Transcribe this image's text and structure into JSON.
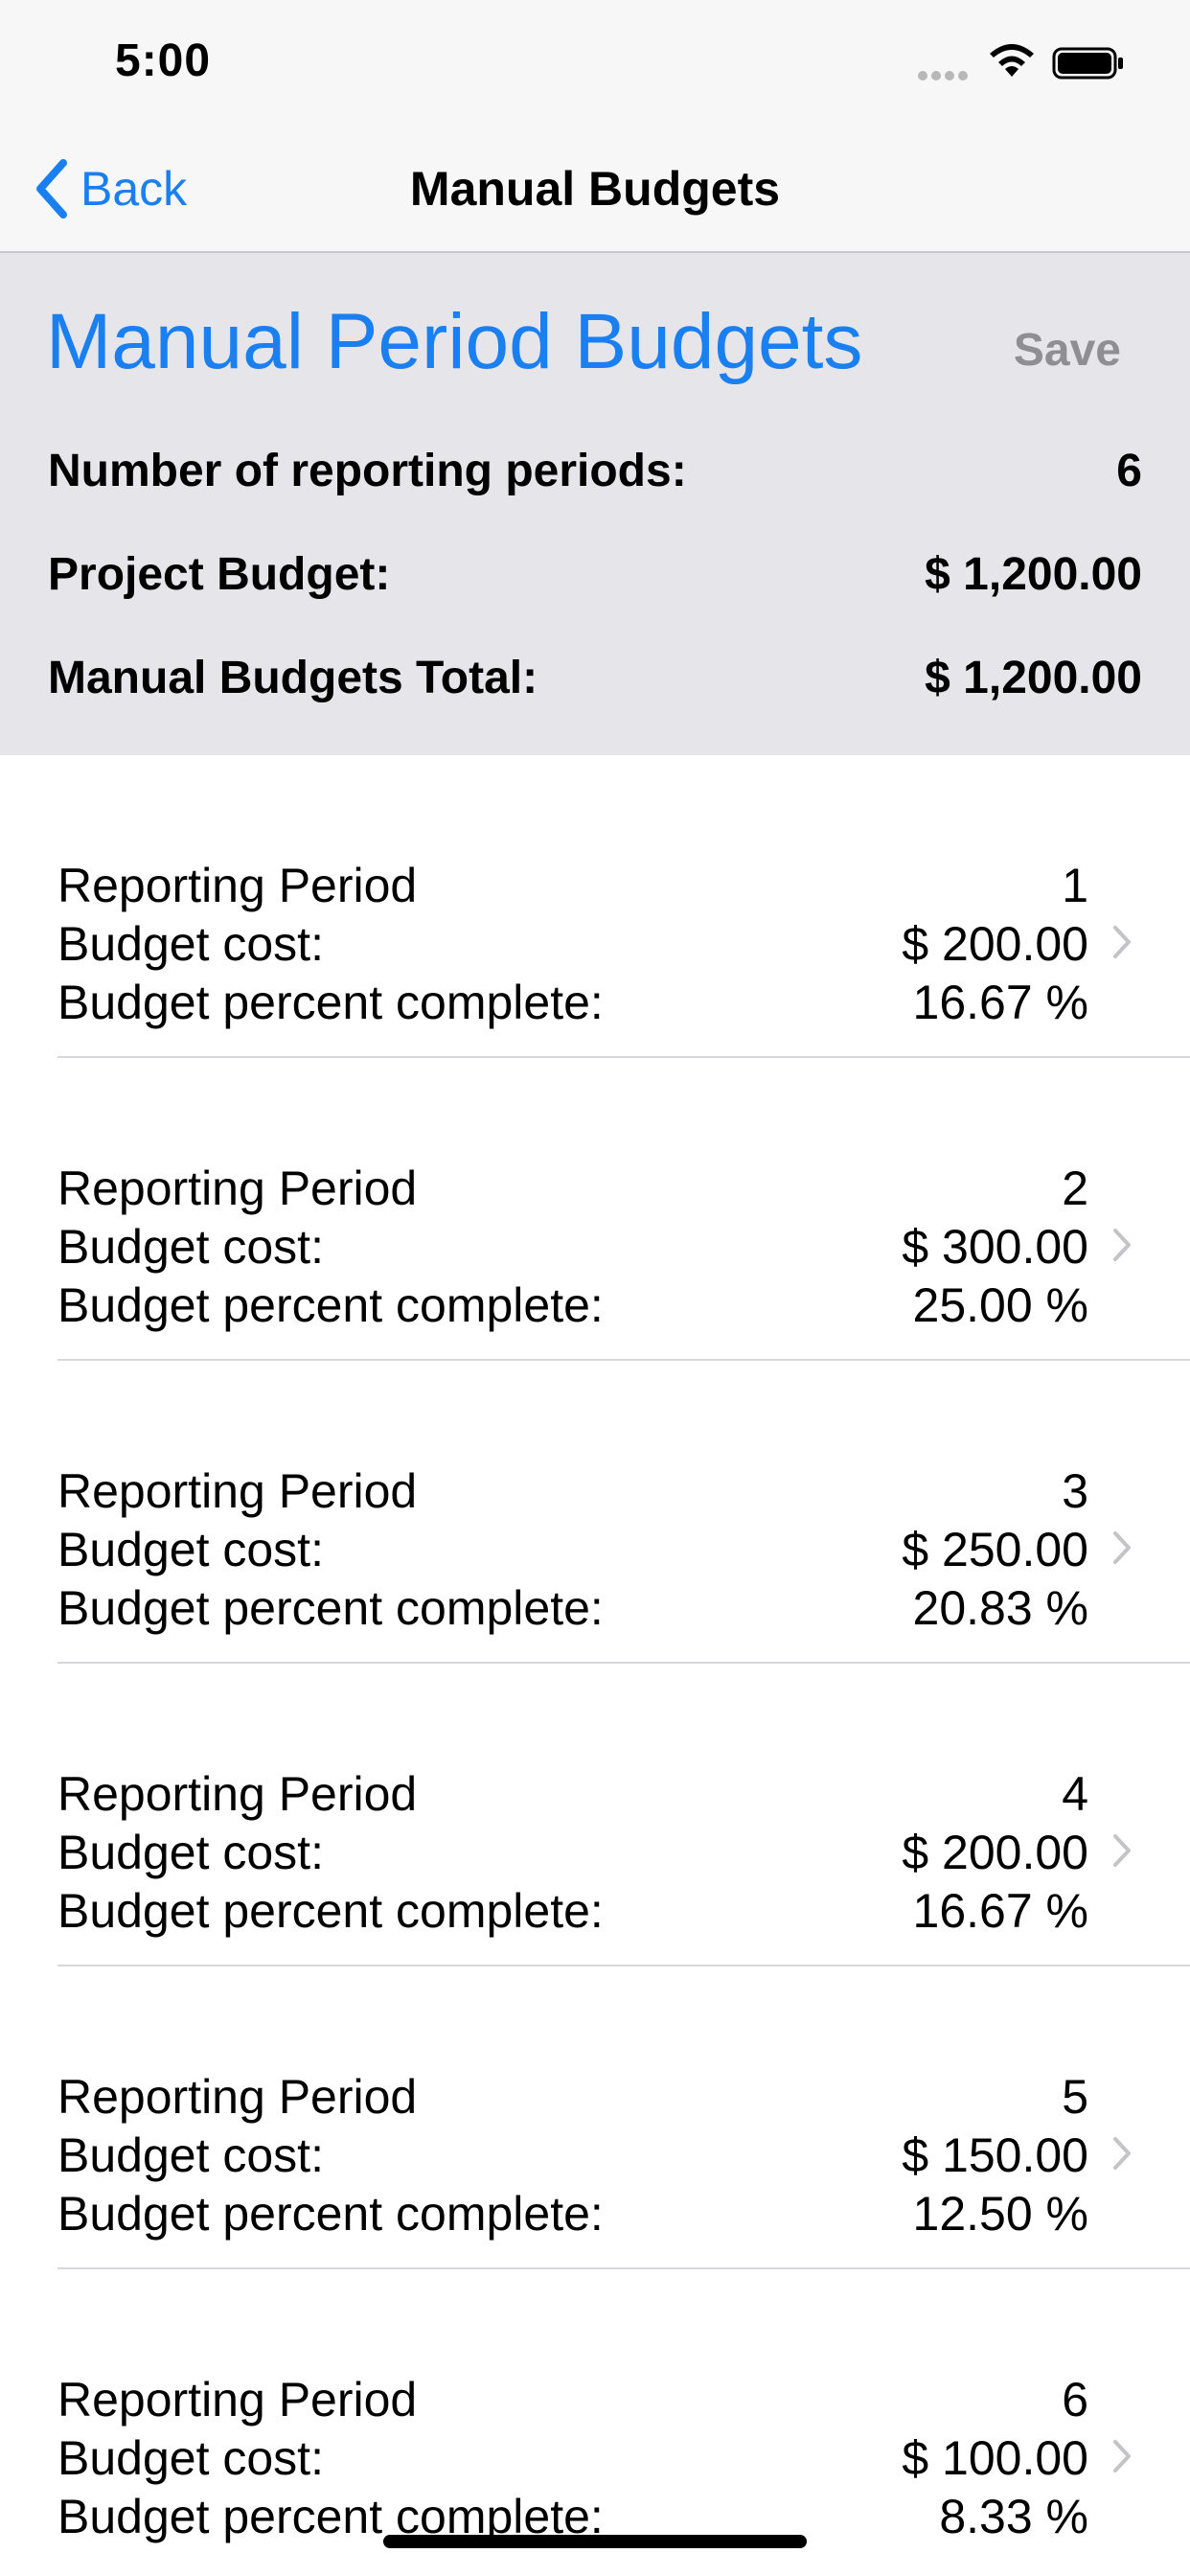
{
  "status_bar": {
    "time": "5:00"
  },
  "nav": {
    "back_label": "Back",
    "title": "Manual Budgets"
  },
  "header": {
    "title": "Manual Period Budgets",
    "save_label": "Save",
    "periods_label": "Number of reporting periods:",
    "periods_value": "6",
    "project_budget_label": "Project Budget:",
    "project_budget_value": "$ 1,200.00",
    "manual_total_label": "Manual Budgets Total:",
    "manual_total_value": "$ 1,200.00"
  },
  "labels": {
    "period": "Reporting Period",
    "cost": "Budget cost:",
    "percent": "Budget percent complete:"
  },
  "periods": [
    {
      "number": "1",
      "cost": "$ 200.00",
      "percent": "16.67 %"
    },
    {
      "number": "2",
      "cost": "$ 300.00",
      "percent": "25.00 %"
    },
    {
      "number": "3",
      "cost": "$ 250.00",
      "percent": "20.83 %"
    },
    {
      "number": "4",
      "cost": "$ 200.00",
      "percent": "16.67 %"
    },
    {
      "number": "5",
      "cost": "$ 150.00",
      "percent": "12.50 %"
    },
    {
      "number": "6",
      "cost": "$ 100.00",
      "percent": "8.33 %"
    }
  ],
  "colors": {
    "accent": "#1a7ff0",
    "header_bg": "#e5e5ea",
    "disabled_text": "#8e8e93"
  },
  "icons": {
    "back": "chevron-left-icon",
    "disclosure": "chevron-right-icon",
    "wifi": "wifi-icon",
    "battery": "battery-icon"
  }
}
